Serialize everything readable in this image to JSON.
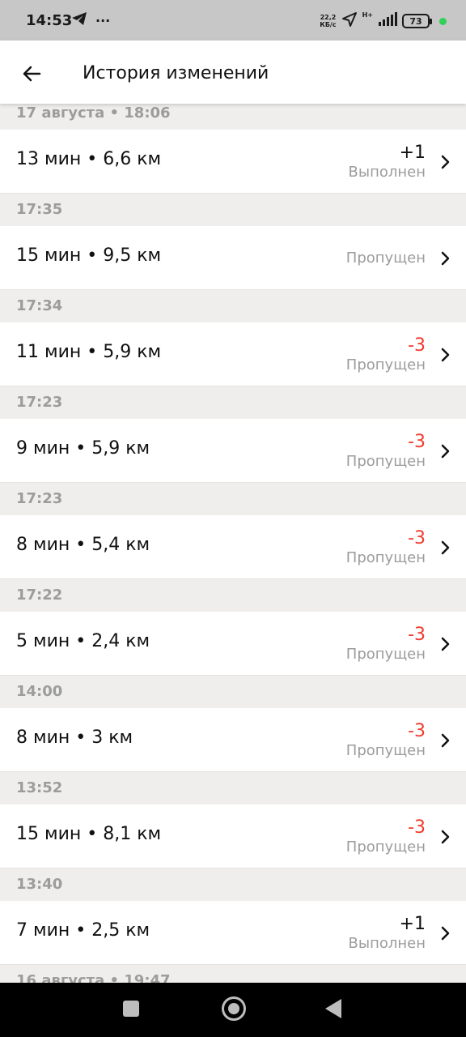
{
  "status_bar": {
    "time": "14:53",
    "more": "···",
    "speed_top": "22,2",
    "speed_bottom": "КБ/с",
    "network": "H+",
    "battery": "73"
  },
  "header": {
    "title": "История изменений"
  },
  "groups": [
    {
      "time": "17 августа • 18:06",
      "main": "13 мин • 6,6 км",
      "delta": "+1",
      "delta_type": "pos",
      "status": "Выполнен"
    },
    {
      "time": "17:35",
      "main": "15 мин • 9,5 км",
      "delta": "",
      "delta_type": "none",
      "status": "Пропущен"
    },
    {
      "time": "17:34",
      "main": "11 мин • 5,9 км",
      "delta": "-3",
      "delta_type": "neg",
      "status": "Пропущен"
    },
    {
      "time": "17:23",
      "main": "9 мин • 5,9 км",
      "delta": "-3",
      "delta_type": "neg",
      "status": "Пропущен"
    },
    {
      "time": "17:23",
      "main": "8 мин • 5,4 км",
      "delta": "-3",
      "delta_type": "neg",
      "status": "Пропущен"
    },
    {
      "time": "17:22",
      "main": "5 мин • 2,4 км",
      "delta": "-3",
      "delta_type": "neg",
      "status": "Пропущен"
    },
    {
      "time": "14:00",
      "main": "8 мин • 3 км",
      "delta": "-3",
      "delta_type": "neg",
      "status": "Пропущен"
    },
    {
      "time": "13:52",
      "main": "15 мин • 8,1 км",
      "delta": "-3",
      "delta_type": "neg",
      "status": "Пропущен"
    },
    {
      "time": "13:40",
      "main": "7 мин • 2,5 км",
      "delta": "+1",
      "delta_type": "pos",
      "status": "Выполнен"
    },
    {
      "time": "16 августа • 19:47",
      "main": "",
      "delta": "",
      "delta_type": "none",
      "status": ""
    }
  ],
  "icons": {
    "back": "arrow-left-icon",
    "chevron": "chevron-right-icon",
    "telegram": "telegram-icon",
    "location": "location-arrow-icon",
    "signal": "signal-icon"
  },
  "colors": {
    "negative": "#f33b2f",
    "muted": "#9c9c9c",
    "section_bg": "#efeeec",
    "status_bar_bg": "#c7c7c7"
  }
}
